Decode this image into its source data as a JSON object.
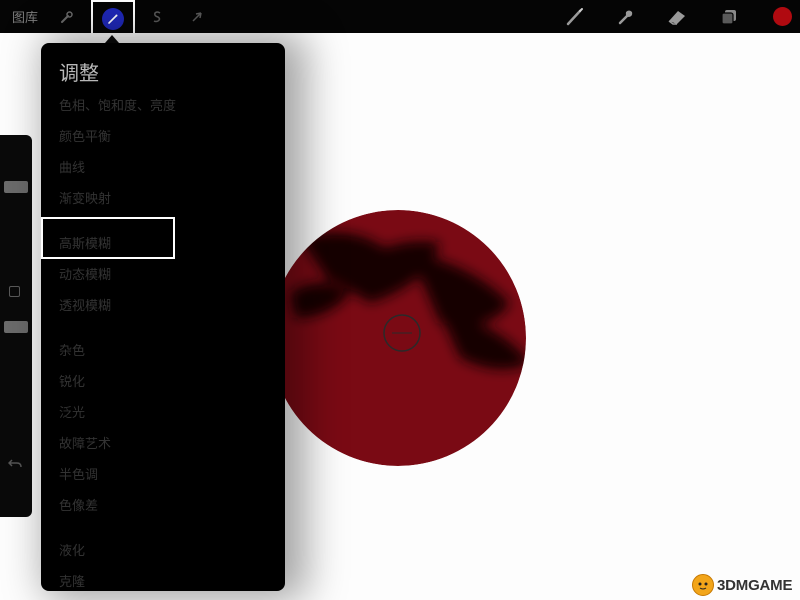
{
  "topbar": {
    "gallery_label": "图库",
    "icons": {
      "actions": "wrench-icon",
      "adjustments": "magic-wand-icon",
      "selection": "selection-s-icon",
      "transform": "arrow-cursor-icon",
      "brush": "brush-icon",
      "smudge": "smudge-icon",
      "eraser": "eraser-icon",
      "layers": "layers-icon",
      "color": "color-swatch"
    },
    "active_color": "#b00a10",
    "adjustments_active_color": "#1f28b8"
  },
  "adjustments_menu": {
    "title": "调整",
    "items": [
      "色相、饱和度、亮度",
      "颜色平衡",
      "曲线",
      "渐变映射",
      "高斯模糊",
      "动态模糊",
      "透视模糊",
      "杂色",
      "锐化",
      "泛光",
      "故障艺术",
      "半色调",
      "色像差",
      "液化",
      "克隆"
    ],
    "highlighted_item": "高斯模糊"
  },
  "canvas": {
    "shape_color": "#7a0a14"
  },
  "watermark": {
    "text": "3DMGAME"
  }
}
